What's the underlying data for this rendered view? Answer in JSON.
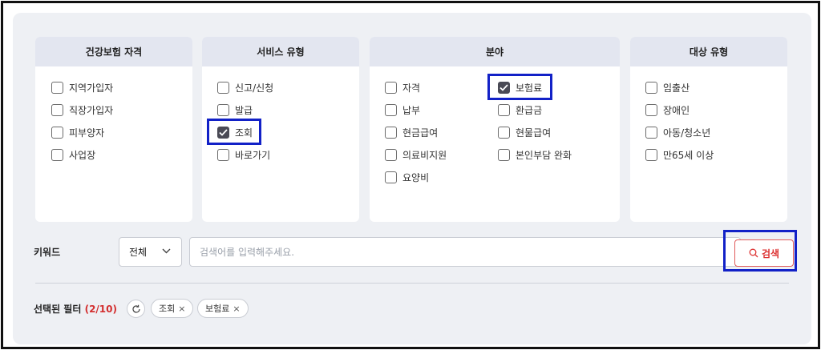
{
  "filters": {
    "eligibility": {
      "title": "건강보험 자격",
      "options": [
        "지역가입자",
        "직장가입자",
        "피부양자",
        "사업장"
      ]
    },
    "service_type": {
      "title": "서비스 유형",
      "options": [
        "신고/신청",
        "발급",
        "조회",
        "바로가기"
      ]
    },
    "field": {
      "title": "분야",
      "options": [
        "자격",
        "납부",
        "현금급여",
        "의료비지원",
        "요양비",
        "보험료",
        "환급금",
        "현물급여",
        "본인부담 완화"
      ]
    },
    "target": {
      "title": "대상 유형",
      "options": [
        "임출산",
        "장애인",
        "아동/청소년",
        "만65세 이상"
      ]
    }
  },
  "checked": [
    "조회",
    "보험료"
  ],
  "keyword": {
    "label": "키워드",
    "scope_selected": "전체",
    "placeholder": "검색어를 입력해주세요.",
    "search_label": "검색"
  },
  "selected_filters": {
    "label": "선택된 필터",
    "count": "(2/10)",
    "chips": [
      "조회",
      "보험료"
    ],
    "remove_symbol": "×"
  },
  "colors": {
    "accent_red": "#d33333",
    "highlight_blue": "#1221c7",
    "header_bg": "#e3e6f0",
    "panel_bg": "#eef0f4"
  }
}
